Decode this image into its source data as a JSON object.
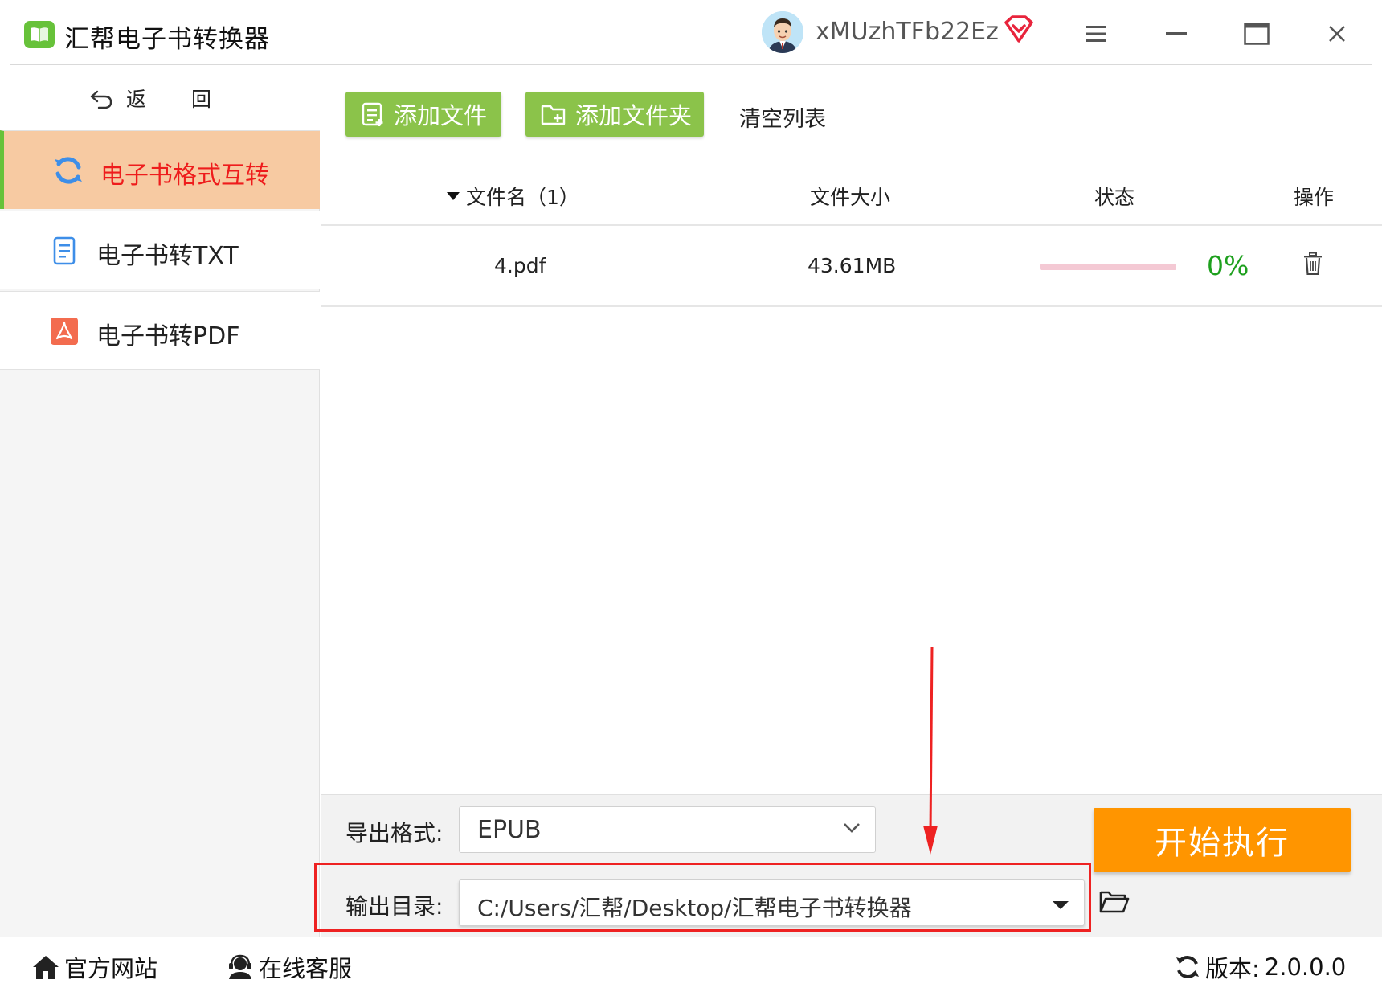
{
  "app": {
    "title": "汇帮电子书转换器",
    "username": "xMUzhTFb22Ez"
  },
  "sidebar": {
    "back_label": "返 回",
    "items": [
      {
        "label": "电子书格式互转",
        "icon": "refresh-icon",
        "active": true
      },
      {
        "label": "电子书转TXT",
        "icon": "document-icon",
        "active": false
      },
      {
        "label": "电子书转PDF",
        "icon": "pdf-icon",
        "active": false
      }
    ]
  },
  "toolbar": {
    "add_file_label": "添加文件",
    "add_folder_label": "添加文件夹",
    "clear_label": "清空列表"
  },
  "table": {
    "headers": {
      "name": "文件名（1）",
      "size": "文件大小",
      "status": "状态",
      "operation": "操作"
    },
    "rows": [
      {
        "name": "4.pdf",
        "size": "43.61MB",
        "progress": 0,
        "progress_text": "0%"
      }
    ]
  },
  "settings": {
    "format_label": "导出格式:",
    "format_value": "EPUB",
    "output_dir_label": "输出目录:",
    "output_dir_value": "C:/Users/汇帮/Desktop/汇帮电子书转换器",
    "start_label": "开始执行"
  },
  "footer": {
    "website_label": "官方网站",
    "service_label": "在线客服",
    "version_label": "版本:",
    "version_value": "2.0.0.0"
  },
  "colors": {
    "accent_green": "#8bc34a",
    "active_nav_bg": "#f7caa2",
    "active_nav_text": "#ee1c1c",
    "start_button": "#ff9500",
    "progress_track": "#f4c9d4",
    "progress_text": "#1ea01e",
    "annotation_red": "#ee2222"
  }
}
